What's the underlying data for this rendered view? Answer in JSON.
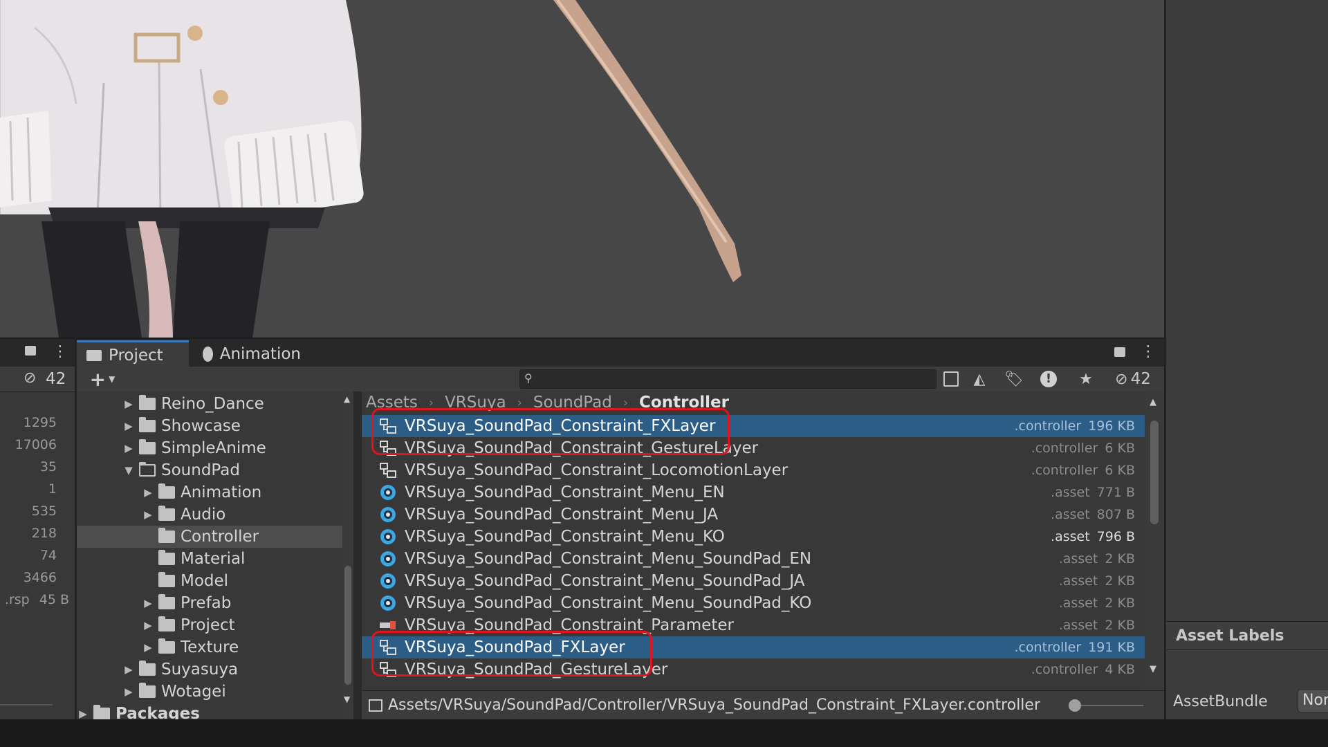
{
  "tabs": [
    {
      "label": "Project"
    },
    {
      "label": "Animation"
    }
  ],
  "left_panel": {
    "hidden_count": "42",
    "values": [
      "1295",
      "17006",
      "35",
      "1",
      "535",
      "218",
      "74",
      "3466"
    ],
    "last_row_label": ".rsp",
    "last_row_value": "45 B"
  },
  "toolbar": {
    "add_label": "+",
    "hidden_count": "42"
  },
  "tree": [
    {
      "label": "Reino_Dance",
      "depth": 0,
      "expandable": true
    },
    {
      "label": "Showcase",
      "depth": 0,
      "expandable": true
    },
    {
      "label": "SimpleAnime",
      "depth": 0,
      "expandable": true
    },
    {
      "label": "SoundPad",
      "depth": 0,
      "expanded": true
    },
    {
      "label": "Animation",
      "depth": 1,
      "expandable": true
    },
    {
      "label": "Audio",
      "depth": 1,
      "expandable": true
    },
    {
      "label": "Controller",
      "depth": 1,
      "selected": true
    },
    {
      "label": "Material",
      "depth": 1
    },
    {
      "label": "Model",
      "depth": 1
    },
    {
      "label": "Prefab",
      "depth": 1,
      "expandable": true
    },
    {
      "label": "Project",
      "depth": 1,
      "expandable": true
    },
    {
      "label": "Texture",
      "depth": 1,
      "expandable": true
    },
    {
      "label": "Suyasuya",
      "depth": 0,
      "expandable": true
    },
    {
      "label": "Wotagei",
      "depth": 0,
      "expandable": true
    },
    {
      "label": "Packages",
      "depth": -1,
      "expandable": true
    }
  ],
  "breadcrumb": [
    "Assets",
    "VRSuya",
    "SoundPad",
    "Controller"
  ],
  "files": [
    {
      "name": "VRSuya_SoundPad_Constraint_FXLayer",
      "ext": ".controller",
      "size": "196 KB",
      "type": "controller",
      "selected": true
    },
    {
      "name": "VRSuya_SoundPad_Constraint_GestureLayer",
      "ext": ".controller",
      "size": "6 KB",
      "type": "controller"
    },
    {
      "name": "VRSuya_SoundPad_Constraint_LocomotionLayer",
      "ext": ".controller",
      "size": "6 KB",
      "type": "controller"
    },
    {
      "name": "VRSuya_SoundPad_Constraint_Menu_EN",
      "ext": ".asset",
      "size": "771 B",
      "type": "menu"
    },
    {
      "name": "VRSuya_SoundPad_Constraint_Menu_JA",
      "ext": ".asset",
      "size": "807 B",
      "type": "menu"
    },
    {
      "name": "VRSuya_SoundPad_Constraint_Menu_KO",
      "ext": ".asset",
      "size": "796 B",
      "type": "menu",
      "hover": true
    },
    {
      "name": "VRSuya_SoundPad_Constraint_Menu_SoundPad_EN",
      "ext": ".asset",
      "size": "2 KB",
      "type": "menu"
    },
    {
      "name": "VRSuya_SoundPad_Constraint_Menu_SoundPad_JA",
      "ext": ".asset",
      "size": "2 KB",
      "type": "menu"
    },
    {
      "name": "VRSuya_SoundPad_Constraint_Menu_SoundPad_KO",
      "ext": ".asset",
      "size": "2 KB",
      "type": "menu"
    },
    {
      "name": "VRSuya_SoundPad_Constraint_Parameter",
      "ext": ".asset",
      "size": "2 KB",
      "type": "parameter"
    },
    {
      "name": "VRSuya_SoundPad_FXLayer",
      "ext": ".controller",
      "size": "191 KB",
      "type": "controller",
      "selected": true
    },
    {
      "name": "VRSuya_SoundPad_GestureLayer",
      "ext": ".controller",
      "size": "4 KB",
      "type": "controller"
    }
  ],
  "status_path": "Assets/VRSuya/SoundPad/Controller/VRSuya_SoundPad_Constraint_FXLayer.controller",
  "inspector": {
    "asset_labels": "Asset Labels",
    "asset_bundle_label": "AssetBundle",
    "asset_bundle_value": "Nor"
  },
  "colors": {
    "selection": "#2c5d87",
    "highlight_box": "#e0141e",
    "tab_accent": "#3a79bb"
  }
}
